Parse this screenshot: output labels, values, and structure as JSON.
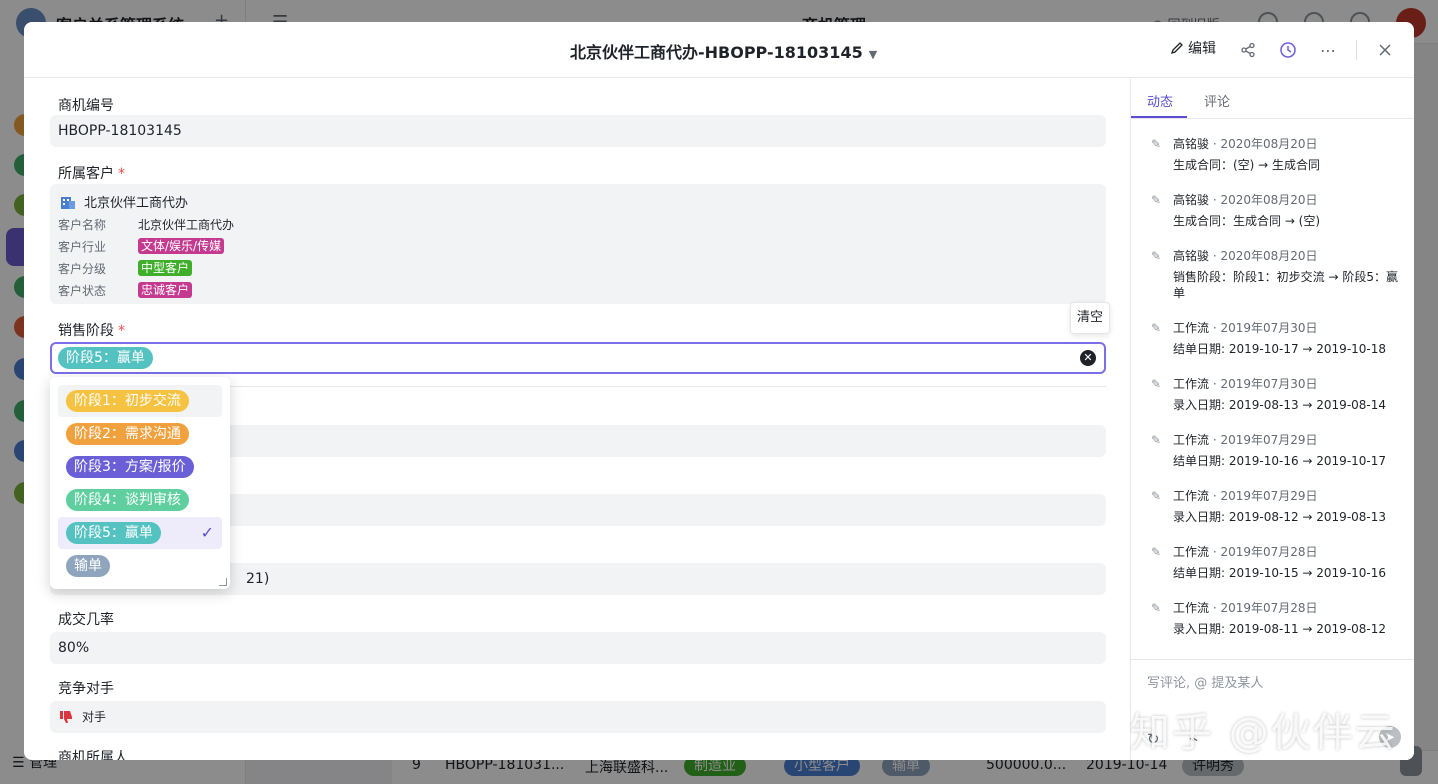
{
  "background": {
    "app_name": "客户关系管理系统",
    "page_title": "商机管理",
    "back_label": "回到旧版",
    "footer_label": "管理",
    "table_row": {
      "index": "9",
      "opp_id": "HBOPP-181031...",
      "customer": "上海联盛科...",
      "industry": "制造业",
      "level": "小型客户",
      "stage": "输单",
      "amount": "500000.0...",
      "date": "2019-10-14",
      "owner": "许明秀"
    }
  },
  "modal": {
    "title": "北京伙伴工商代办-HBOPP-18103145",
    "edit_label": "编辑",
    "fields": {
      "opp_no_label": "商机编号",
      "opp_no_value": "HBOPP-18103145",
      "customer_label": "所属客户",
      "customer": {
        "name": "北京伙伴工商代办",
        "rows": [
          {
            "label": "客户名称",
            "value": "北京伙伴工商代办"
          },
          {
            "label": "客户行业",
            "value": "文体/娱乐/传媒"
          },
          {
            "label": "客户分级",
            "value": "中型客户"
          },
          {
            "label": "客户状态",
            "value": "忠诚客户"
          }
        ]
      },
      "stage_label": "销售阶段",
      "stage_value": "阶段5：赢单",
      "clear_tooltip": "清空",
      "hidden_partial_value": "21)",
      "probability_label": "成交几率",
      "probability_value": "80%",
      "competitor_label": "竞争对手",
      "competitor_value": "对手",
      "owner_label": "商机所属人"
    },
    "stage_options": [
      {
        "label": "阶段1：初步交流",
        "color": "#f5c242"
      },
      {
        "label": "阶段2：需求沟通",
        "color": "#f0a03c"
      },
      {
        "label": "阶段3：方案/报价",
        "color": "#6a5fd6"
      },
      {
        "label": "阶段4：谈判审核",
        "color": "#5fcf9f"
      },
      {
        "label": "阶段5：赢单",
        "color": "#55c2c2"
      },
      {
        "label": "输单",
        "color": "#8ea5bd"
      }
    ]
  },
  "activity_panel": {
    "tabs": [
      "动态",
      "评论"
    ],
    "items": [
      {
        "who": "高铭骏",
        "date": "· 2020年08月20日",
        "text": "生成合同：(空) → 生成合同"
      },
      {
        "who": "高铭骏",
        "date": "· 2020年08月20日",
        "text": "生成合同：生成合同 → (空)"
      },
      {
        "who": "高铭骏",
        "date": "· 2020年08月20日",
        "text": "销售阶段：阶段1：初步交流 → 阶段5：赢单"
      },
      {
        "who": "工作流",
        "date": "· 2019年07月30日",
        "text": "结单日期: 2019-10-17 → 2019-10-18"
      },
      {
        "who": "工作流",
        "date": "· 2019年07月30日",
        "text": "录入日期: 2019-08-13 → 2019-08-14"
      },
      {
        "who": "工作流",
        "date": "· 2019年07月29日",
        "text": "结单日期: 2019-10-16 → 2019-10-17"
      },
      {
        "who": "工作流",
        "date": "· 2019年07月29日",
        "text": "录入日期: 2019-08-12 → 2019-08-13"
      },
      {
        "who": "工作流",
        "date": "· 2019年07月28日",
        "text": "结单日期: 2019-10-15 → 2019-10-16"
      },
      {
        "who": "工作流",
        "date": "· 2019年07月28日",
        "text": "录入日期: 2019-08-11 → 2019-08-12"
      }
    ],
    "comment_placeholder": "写评论, @ 提及某人"
  },
  "watermark": "知乎 @伙伴云",
  "colors": {
    "accent": "#5b4ed1",
    "tag_industry": "#c43a8f",
    "tag_level": "#3fae2a",
    "tag_status": "#c43a8f"
  }
}
